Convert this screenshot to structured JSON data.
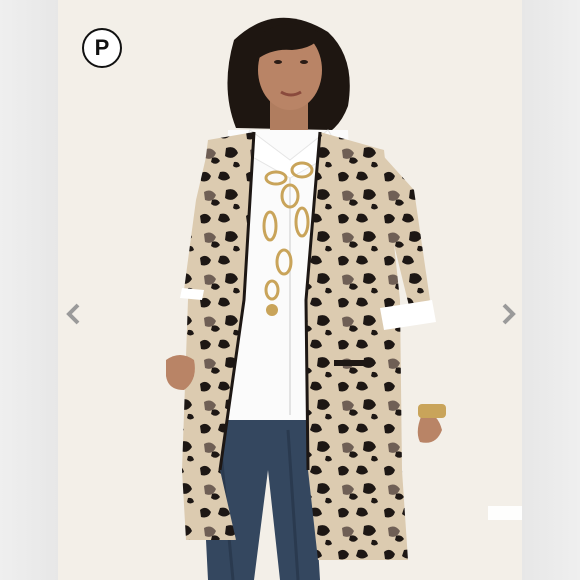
{
  "listing": {
    "brand_badge_letter": "P",
    "accent_color": "#111111",
    "background_color": "#f3efe8"
  },
  "carousel": {
    "prev_icon": "chevron-left-icon",
    "next_icon": "chevron-right-icon",
    "arrow_color": "#9a9a9a"
  }
}
